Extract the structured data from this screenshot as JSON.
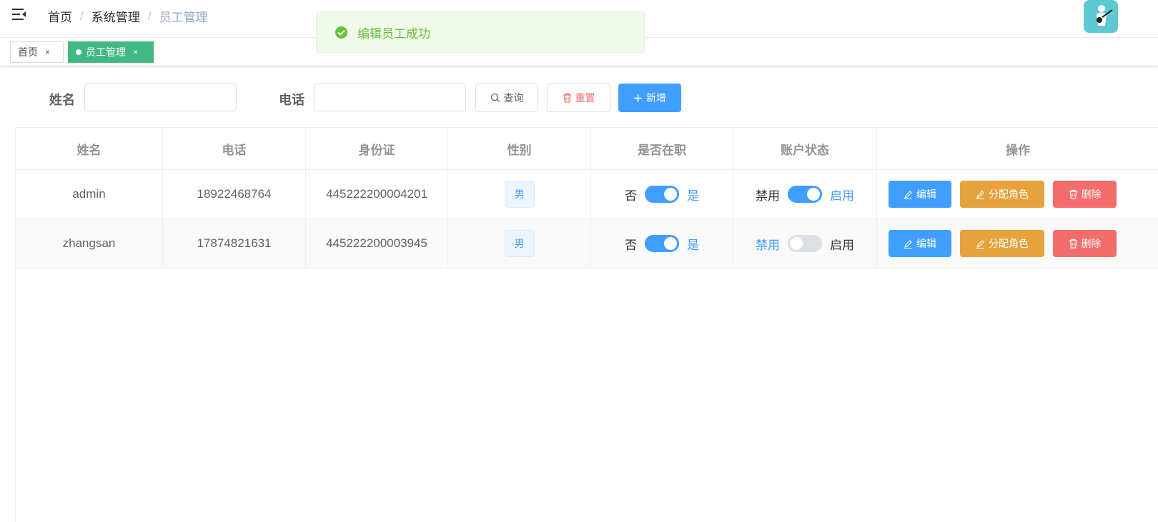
{
  "breadcrumb": [
    "首页",
    "系统管理",
    "员工管理"
  ],
  "tags": [
    {
      "label": "首页",
      "close": "×"
    },
    {
      "label": "员工管理",
      "close": "×"
    }
  ],
  "toast": {
    "message": "编辑员工成功",
    "color": "#67c23a"
  },
  "search": {
    "name_label": "姓名",
    "phone_label": "电话",
    "query_button": "查询",
    "reset_button": "重置",
    "add_button": "新增"
  },
  "table": {
    "columns": [
      "姓名",
      "电话",
      "身份证",
      "性别",
      "是否在职",
      "账户状态",
      "操作"
    ],
    "rows": [
      {
        "name": "admin",
        "phone": "18922468764",
        "id_card": "445222200004201",
        "gender": "男",
        "employed": {
          "off_label": "否",
          "on_label": "是",
          "value": true
        },
        "status": {
          "off_label": "禁用",
          "on_label": "启用",
          "value": true
        }
      },
      {
        "name": "zhangsan",
        "phone": "17874821631",
        "id_card": "445222200003945",
        "gender": "男",
        "employed": {
          "off_label": "否",
          "on_label": "是",
          "value": true
        },
        "status": {
          "off_label": "禁用",
          "on_label": "启用",
          "value": false
        }
      }
    ],
    "actions": {
      "edit": "编辑",
      "assign_role": "分配角色",
      "delete": "删除"
    }
  },
  "colors": {
    "primary": "#409eff",
    "success": "#67c23a",
    "warning": "#e6a23c",
    "danger": "#f56c6c",
    "tag_active": "#42b983"
  }
}
